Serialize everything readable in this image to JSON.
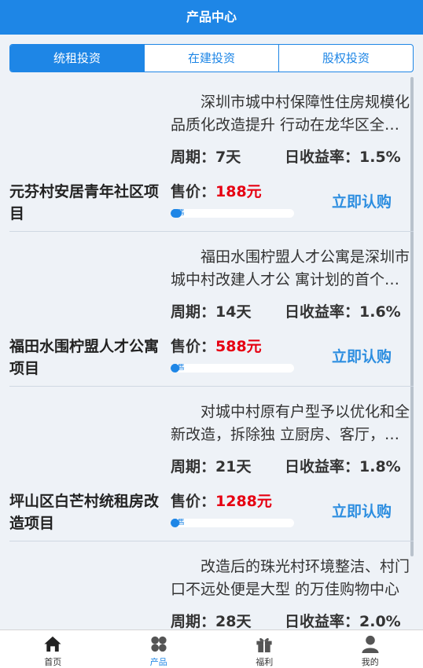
{
  "header": {
    "title": "产品中心"
  },
  "tabs": [
    {
      "label": "统租投资",
      "active": true
    },
    {
      "label": "在建投资",
      "active": false
    },
    {
      "label": "股权投资",
      "active": false
    }
  ],
  "products": [
    {
      "desc": "深圳市城中村保障性住房规模化品质化改造提升 行动在龙华区全面推进",
      "period": "周期：7天",
      "rate": "日收益率：1.5%",
      "title": "元芬村安居青年社区项目",
      "price_label": "售价：",
      "price": "188元",
      "sold_label": "已售",
      "progress": 0.09,
      "buy_label": "立即认购"
    },
    {
      "desc": "福田水围柠盟人才公寓是深圳市城中村改建人才公 寓计划的首个试点项目",
      "period": "周期：14天",
      "rate": "日收益率：1.6%",
      "title": "福田水围柠盟人才公寓项目",
      "price_label": "售价：",
      "price": "588元",
      "sold_label": "已售",
      "progress": 0.04,
      "buy_label": "立即认购"
    },
    {
      "desc": "对城中村原有户型予以优化和全新改造，拆除独 立厨房、客厅，重新设计",
      "period": "周期：21天",
      "rate": "日收益率：1.8%",
      "title": "坪山区白芒村统租房改造项目",
      "price_label": "售价：",
      "price": "1288元",
      "sold_label": "已售",
      "progress": 0.02,
      "buy_label": "立即认购"
    },
    {
      "desc": "改造后的珠光村环境整洁、村门口不远处便是大型 的万佳购物中心",
      "period": "周期：28天",
      "rate": "日收益率：2.0%",
      "title": "",
      "price_label": "",
      "price": "",
      "sold_label": "",
      "progress": 0,
      "buy_label": ""
    }
  ],
  "tabbar": [
    {
      "label": "首页",
      "icon": "home-icon",
      "active": false
    },
    {
      "label": "产品",
      "icon": "grid-icon",
      "active": true
    },
    {
      "label": "福利",
      "icon": "gift-icon",
      "active": false
    },
    {
      "label": "我的",
      "icon": "user-icon",
      "active": false
    }
  ],
  "colors": {
    "primary": "#1e86e6",
    "price": "#e60012",
    "buy": "#2d8ee0"
  }
}
